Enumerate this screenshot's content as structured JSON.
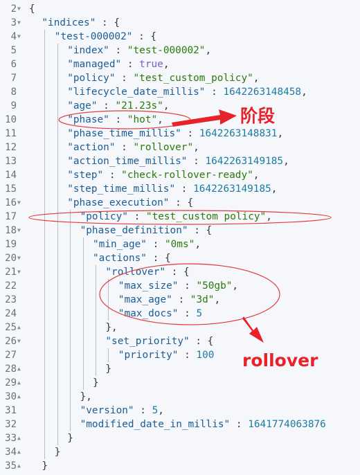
{
  "editor": {
    "theme_colors": {
      "key": "#1a5d96",
      "string": "#2b7a0b",
      "number": "#1a7ca3",
      "boolean": "#7a5bd1",
      "annotation": "#e8222a"
    },
    "lines": [
      {
        "no": "2",
        "fold": "open",
        "indent": 0,
        "tokens": [
          [
            "p",
            "{"
          ]
        ]
      },
      {
        "no": "3",
        "fold": "open",
        "indent": 1,
        "tokens": [
          [
            "k",
            "\"indices\""
          ],
          [
            "p",
            " : {"
          ]
        ]
      },
      {
        "no": "4",
        "fold": "open",
        "indent": 2,
        "tokens": [
          [
            "k",
            "\"test-000002\""
          ],
          [
            "p",
            " : {"
          ]
        ]
      },
      {
        "no": "5",
        "fold": "",
        "indent": 3,
        "tokens": [
          [
            "k",
            "\"index\""
          ],
          [
            "p",
            " : "
          ],
          [
            "s",
            "\"test-000002\""
          ],
          [
            "p",
            ","
          ]
        ]
      },
      {
        "no": "6",
        "fold": "",
        "indent": 3,
        "tokens": [
          [
            "k",
            "\"managed\""
          ],
          [
            "p",
            " : "
          ],
          [
            "b",
            "true"
          ],
          [
            "p",
            ","
          ]
        ]
      },
      {
        "no": "7",
        "fold": "",
        "indent": 3,
        "tokens": [
          [
            "k",
            "\"policy\""
          ],
          [
            "p",
            " : "
          ],
          [
            "s",
            "\"test_custom_policy\""
          ],
          [
            "p",
            ","
          ]
        ]
      },
      {
        "no": "8",
        "fold": "",
        "indent": 3,
        "tokens": [
          [
            "k",
            "\"lifecycle_date_millis\""
          ],
          [
            "p",
            " : "
          ],
          [
            "n",
            "1642263148458"
          ],
          [
            "p",
            ","
          ]
        ]
      },
      {
        "no": "9",
        "fold": "",
        "indent": 3,
        "tokens": [
          [
            "k",
            "\"age\""
          ],
          [
            "p",
            " : "
          ],
          [
            "s",
            "\"21.23s\""
          ],
          [
            "p",
            ","
          ]
        ]
      },
      {
        "no": "10",
        "fold": "",
        "indent": 3,
        "tokens": [
          [
            "k",
            "\"phase\""
          ],
          [
            "p",
            " : "
          ],
          [
            "s",
            "\"hot\""
          ],
          [
            "p",
            ","
          ]
        ]
      },
      {
        "no": "11",
        "fold": "",
        "indent": 3,
        "tokens": [
          [
            "k",
            "\"phase_time_millis\""
          ],
          [
            "p",
            " : "
          ],
          [
            "n",
            "1642263148831"
          ],
          [
            "p",
            ","
          ]
        ]
      },
      {
        "no": "12",
        "fold": "",
        "indent": 3,
        "tokens": [
          [
            "k",
            "\"action\""
          ],
          [
            "p",
            " : "
          ],
          [
            "s",
            "\"rollover\""
          ],
          [
            "p",
            ","
          ]
        ]
      },
      {
        "no": "13",
        "fold": "",
        "indent": 3,
        "tokens": [
          [
            "k",
            "\"action_time_millis\""
          ],
          [
            "p",
            " : "
          ],
          [
            "n",
            "1642263149185"
          ],
          [
            "p",
            ","
          ]
        ]
      },
      {
        "no": "14",
        "fold": "",
        "indent": 3,
        "tokens": [
          [
            "k",
            "\"step\""
          ],
          [
            "p",
            " : "
          ],
          [
            "s",
            "\"check-rollover-ready\""
          ],
          [
            "p",
            ","
          ]
        ]
      },
      {
        "no": "15",
        "fold": "",
        "indent": 3,
        "tokens": [
          [
            "k",
            "\"step_time_millis\""
          ],
          [
            "p",
            " : "
          ],
          [
            "n",
            "1642263149185"
          ],
          [
            "p",
            ","
          ]
        ]
      },
      {
        "no": "16",
        "fold": "open",
        "indent": 3,
        "tokens": [
          [
            "k",
            "\"phase_execution\""
          ],
          [
            "p",
            " : {"
          ]
        ]
      },
      {
        "no": "17",
        "fold": "",
        "indent": 4,
        "tokens": [
          [
            "k",
            "\"policy\""
          ],
          [
            "p",
            " : "
          ],
          [
            "s",
            "\"test_custom policy\""
          ],
          [
            "p",
            ","
          ]
        ]
      },
      {
        "no": "18",
        "fold": "open",
        "indent": 4,
        "tokens": [
          [
            "k",
            "\"phase_definition\""
          ],
          [
            "p",
            " : {"
          ]
        ]
      },
      {
        "no": "19",
        "fold": "",
        "indent": 5,
        "tokens": [
          [
            "k",
            "\"min_age\""
          ],
          [
            "p",
            " : "
          ],
          [
            "s",
            "\"0ms\""
          ],
          [
            "p",
            ","
          ]
        ]
      },
      {
        "no": "20",
        "fold": "open",
        "indent": 5,
        "tokens": [
          [
            "k",
            "\"actions\""
          ],
          [
            "p",
            " : {"
          ]
        ]
      },
      {
        "no": "21",
        "fold": "open",
        "indent": 6,
        "tokens": [
          [
            "k",
            "\"rollover\""
          ],
          [
            "p",
            " : {"
          ]
        ]
      },
      {
        "no": "22",
        "fold": "",
        "indent": 7,
        "tokens": [
          [
            "k",
            "\"max_size\""
          ],
          [
            "p",
            " : "
          ],
          [
            "s",
            "\"50gb\""
          ],
          [
            "p",
            ","
          ]
        ]
      },
      {
        "no": "23",
        "fold": "",
        "indent": 7,
        "tokens": [
          [
            "k",
            "\"max_age\""
          ],
          [
            "p",
            " : "
          ],
          [
            "s",
            "\"3d\""
          ],
          [
            "p",
            ","
          ]
        ]
      },
      {
        "no": "24",
        "fold": "",
        "indent": 7,
        "tokens": [
          [
            "k",
            "\"max_docs\""
          ],
          [
            "p",
            " : "
          ],
          [
            "n",
            "5"
          ]
        ]
      },
      {
        "no": "25",
        "fold": "close",
        "indent": 6,
        "tokens": [
          [
            "p",
            "},"
          ]
        ]
      },
      {
        "no": "26",
        "fold": "open",
        "indent": 6,
        "tokens": [
          [
            "k",
            "\"set_priority\""
          ],
          [
            "p",
            " : {"
          ]
        ]
      },
      {
        "no": "27",
        "fold": "",
        "indent": 7,
        "tokens": [
          [
            "k",
            "\"priority\""
          ],
          [
            "p",
            " : "
          ],
          [
            "n",
            "100"
          ]
        ]
      },
      {
        "no": "28",
        "fold": "close",
        "indent": 6,
        "tokens": [
          [
            "p",
            "}"
          ]
        ]
      },
      {
        "no": "29",
        "fold": "close",
        "indent": 5,
        "tokens": [
          [
            "p",
            "}"
          ]
        ]
      },
      {
        "no": "30",
        "fold": "close",
        "indent": 4,
        "tokens": [
          [
            "p",
            "},"
          ]
        ]
      },
      {
        "no": "31",
        "fold": "",
        "indent": 4,
        "tokens": [
          [
            "k",
            "\"version\""
          ],
          [
            "p",
            " : "
          ],
          [
            "n",
            "5"
          ],
          [
            "p",
            ","
          ]
        ]
      },
      {
        "no": "32",
        "fold": "",
        "indent": 4,
        "tokens": [
          [
            "k",
            "\"modified_date_in_millis\""
          ],
          [
            "p",
            " : "
          ],
          [
            "n",
            "1641774063876"
          ]
        ]
      },
      {
        "no": "33",
        "fold": "close",
        "indent": 3,
        "tokens": [
          [
            "p",
            "}"
          ]
        ]
      },
      {
        "no": "34",
        "fold": "close",
        "indent": 2,
        "tokens": [
          [
            "p",
            "}"
          ]
        ]
      },
      {
        "no": "35",
        "fold": "close",
        "indent": 1,
        "tokens": [
          [
            "p",
            "}"
          ]
        ]
      }
    ]
  },
  "annotations": {
    "phase_label": "阶段",
    "rollover_label": "rollover"
  }
}
